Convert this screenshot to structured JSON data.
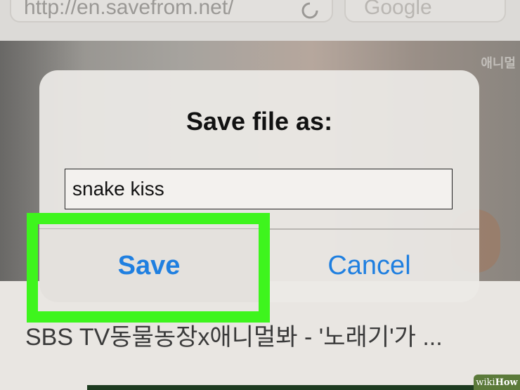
{
  "browser": {
    "url": "http://en.savefrom.net/",
    "search_placeholder": "Google"
  },
  "dialog": {
    "title": "Save file as:",
    "filename_value": "snake kiss",
    "save_label": "Save",
    "cancel_label": "Cancel"
  },
  "page": {
    "video_title": "SBS TV동물농장x애니멀봐 - '노래기'가 ...",
    "thumbnail_logo": "애니멀"
  },
  "watermark": {
    "wiki": "wiki",
    "how": "How"
  },
  "colors": {
    "accent": "#1f7fe0",
    "highlight": "#3ef51d"
  },
  "icons": {
    "reload": "reload-icon"
  }
}
